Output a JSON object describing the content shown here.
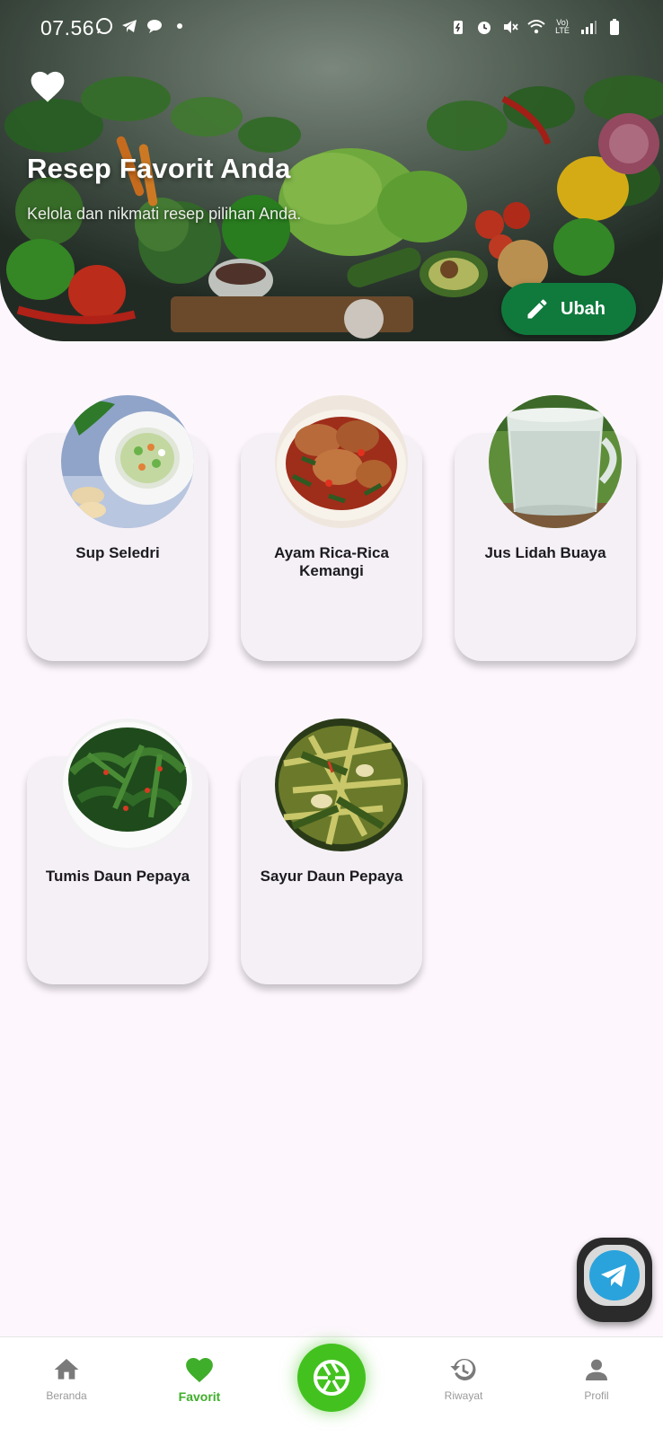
{
  "status_bar": {
    "time": "07.56",
    "left_icons": [
      "whatsapp-icon",
      "telegram-icon",
      "chat-bubble-icon",
      "dot-icon"
    ],
    "right_icons": [
      "battery-saver-icon",
      "alarm-icon",
      "mute-icon",
      "wifi-icon",
      "volte-icon",
      "signal-icon",
      "battery-icon"
    ],
    "volte_label": "Vo) LTE"
  },
  "hero": {
    "title": "Resep Favorit Anda",
    "subtitle": "Kelola dan nikmati resep pilihan Anda.",
    "edit_label": "Ubah",
    "heart_icon": "heart-icon",
    "edit_icon": "pencil-icon"
  },
  "recipes": [
    {
      "name": "Sup Seledri"
    },
    {
      "name": "Ayam Rica-Rica Kemangi"
    },
    {
      "name": "Jus Lidah Buaya"
    },
    {
      "name": "Tumis Daun Pepaya"
    },
    {
      "name": "Sayur Daun Pepaya"
    }
  ],
  "nav": {
    "items": [
      {
        "label": "Beranda",
        "icon": "home-icon"
      },
      {
        "label": "Favorit",
        "icon": "heart-icon",
        "active": true
      },
      {
        "label": "",
        "icon": "camera-aperture-icon"
      },
      {
        "label": "Riwayat",
        "icon": "history-icon"
      },
      {
        "label": "Profil",
        "icon": "person-icon"
      }
    ]
  },
  "floating_button": {
    "icon": "telegram-icon"
  },
  "colors": {
    "primary_green": "#0f7a3c",
    "accent_green": "#43c21f",
    "active_nav": "#3fae2a",
    "background": "#fdf7fd",
    "card": "#f5f0f6",
    "telegram_blue": "#2aa3dc"
  }
}
